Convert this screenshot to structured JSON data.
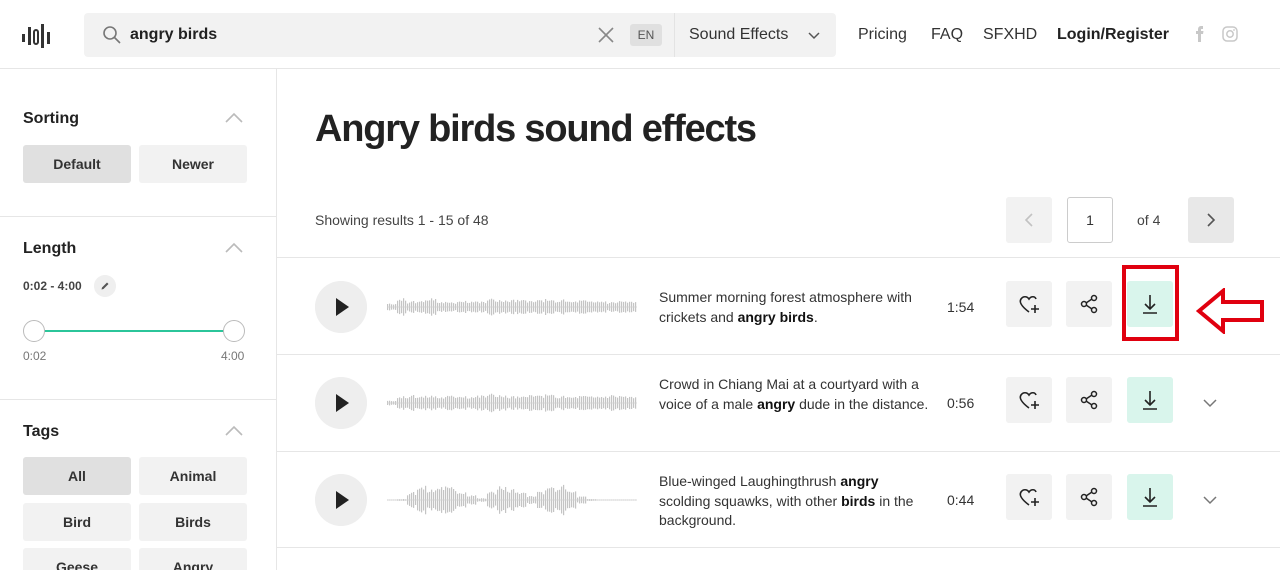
{
  "header": {
    "search": {
      "value": "angry birds",
      "lang": "EN"
    },
    "category": "Sound Effects",
    "nav": [
      "Pricing",
      "FAQ",
      "SFXHD"
    ],
    "login": "Login/Register",
    "social_icons": [
      "facebook-icon",
      "instagram-icon"
    ]
  },
  "sidebar": {
    "sorting": {
      "title": "Sorting",
      "options": [
        "Default",
        "Newer"
      ],
      "selected": "Default"
    },
    "length": {
      "title": "Length",
      "range": "0:02 - 4:00",
      "min_label": "0:02",
      "max_label": "4:00"
    },
    "tags": {
      "title": "Tags",
      "items": [
        "All",
        "Animal",
        "Bird",
        "Birds",
        "Geese",
        "Angry"
      ],
      "selected": "All"
    }
  },
  "main": {
    "title": "Angry birds sound effects",
    "results": "Showing results 1 - 15 of 48",
    "pagination": {
      "page": "1",
      "of": "of 4"
    },
    "rows": [
      {
        "parts": [
          "Summer morning forest atmosphere with crickets and ",
          "angry birds",
          "."
        ],
        "duration": "1:54"
      },
      {
        "parts": [
          "Crowd in Chiang Mai at a courtyard with a voice of a male ",
          "angry",
          " dude in the distance."
        ],
        "duration": "0:56"
      },
      {
        "parts": [
          "Blue-winged Laughingthrush ",
          "angry",
          " scolding squawks, with other ",
          "birds",
          " in the background."
        ],
        "duration": "0:44"
      }
    ]
  },
  "colors": {
    "accent_green": "#2bc59a",
    "download_bg": "#d9f5ec",
    "highlight_red": "#e0000f"
  }
}
